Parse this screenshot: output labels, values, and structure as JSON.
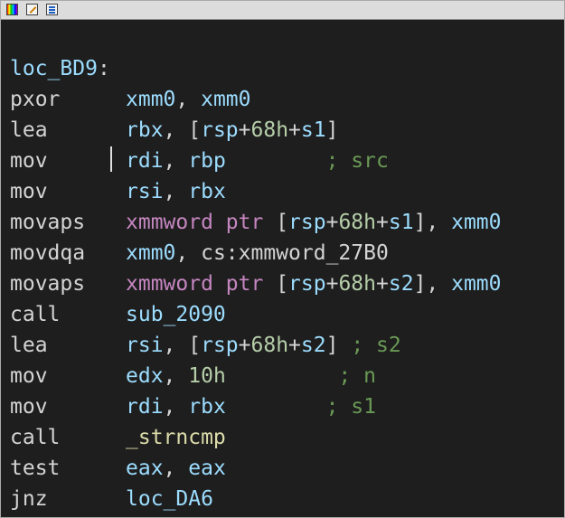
{
  "toolbar": {
    "icons": [
      "color-palette-icon",
      "edit-icon",
      "graph-view-icon"
    ]
  },
  "disassembly": {
    "label": "loc_BD9",
    "label_suffix": ":",
    "lines": [
      {
        "mnemonic": "pxor",
        "op1": "xmm0",
        "sep": ", ",
        "op2": "xmm0"
      },
      {
        "mnemonic": "lea",
        "a": "rbx",
        "b": ", [",
        "c": "rsp",
        "d": "+",
        "e": "68h",
        "f": "+",
        "g": "s1",
        "h": "]"
      },
      {
        "mnemonic": "mov",
        "op1": "rdi",
        "sep": ", ",
        "op2": "rbp",
        "pad": "        ",
        "comment": "; src"
      },
      {
        "mnemonic": "mov",
        "op1": "rsi",
        "sep": ", ",
        "op2": "rbx"
      },
      {
        "mnemonic": "movaps",
        "k1": "xmmword",
        "k2": "ptr",
        "b": " [",
        "c": "rsp",
        "d": "+",
        "e": "68h",
        "f": "+",
        "g": "s1",
        "h": "], ",
        "r": "xmm0"
      },
      {
        "mnemonic": "movdqa",
        "op1": "xmm0",
        "sep": ", ",
        "seg": "cs",
        "colon": ":",
        "sym": "xmmword_27B0"
      },
      {
        "mnemonic": "movaps",
        "k1": "xmmword",
        "k2": "ptr",
        "b": " [",
        "c": "rsp",
        "d": "+",
        "e": "68h",
        "f": "+",
        "g": "s2",
        "h": "], ",
        "r": "xmm0"
      },
      {
        "mnemonic": "call",
        "func": "sub_2090"
      },
      {
        "mnemonic": "lea",
        "a": "rsi",
        "b": ", [",
        "c": "rsp",
        "d": "+",
        "e": "68h",
        "f": "+",
        "g": "s2",
        "h": "] ",
        "comment": "; s2"
      },
      {
        "mnemonic": "mov",
        "op1": "edx",
        "sep": ", ",
        "num": "10h",
        "pad": "         ",
        "comment": "; n"
      },
      {
        "mnemonic": "mov",
        "op1": "rdi",
        "sep": ", ",
        "op2": "rbx",
        "pad": "        ",
        "comment": "; s1"
      },
      {
        "mnemonic": "call",
        "func": "_strncmp"
      },
      {
        "mnemonic": "test",
        "op1": "eax",
        "sep": ", ",
        "op2": "eax"
      },
      {
        "mnemonic": "jnz",
        "label": "loc_DA6"
      }
    ]
  }
}
